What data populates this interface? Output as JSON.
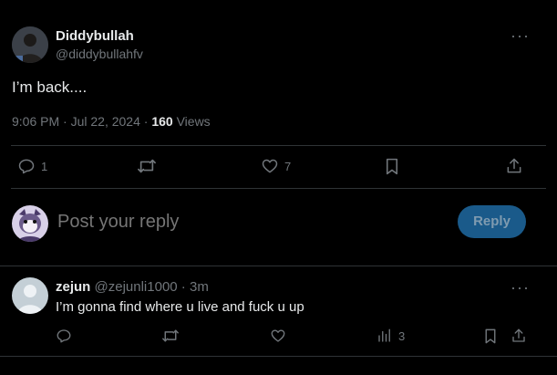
{
  "tweet": {
    "author_name": "Diddybullah",
    "author_handle": "@diddybullahfv",
    "text": "I’m back....",
    "time": "9:06 PM",
    "sep1": " · ",
    "date": "Jul 22, 2024",
    "sep2": " · ",
    "views_count": "160",
    "views_label": " Views",
    "actions": {
      "replies": "1",
      "likes": "7"
    }
  },
  "reply_box": {
    "placeholder": "Post your reply",
    "button_label": "Reply"
  },
  "reply": {
    "author_name": "zejun",
    "author_handle": "@zejunli1000",
    "sep": " · ",
    "time": "3m",
    "text": "I’m gonna find where u live and fuck u up",
    "views": "3"
  },
  "colors": {
    "accent": "#1d9bf0",
    "button_bg": "#1a5a8a",
    "divider": "#2f3336",
    "muted": "#71767b"
  }
}
